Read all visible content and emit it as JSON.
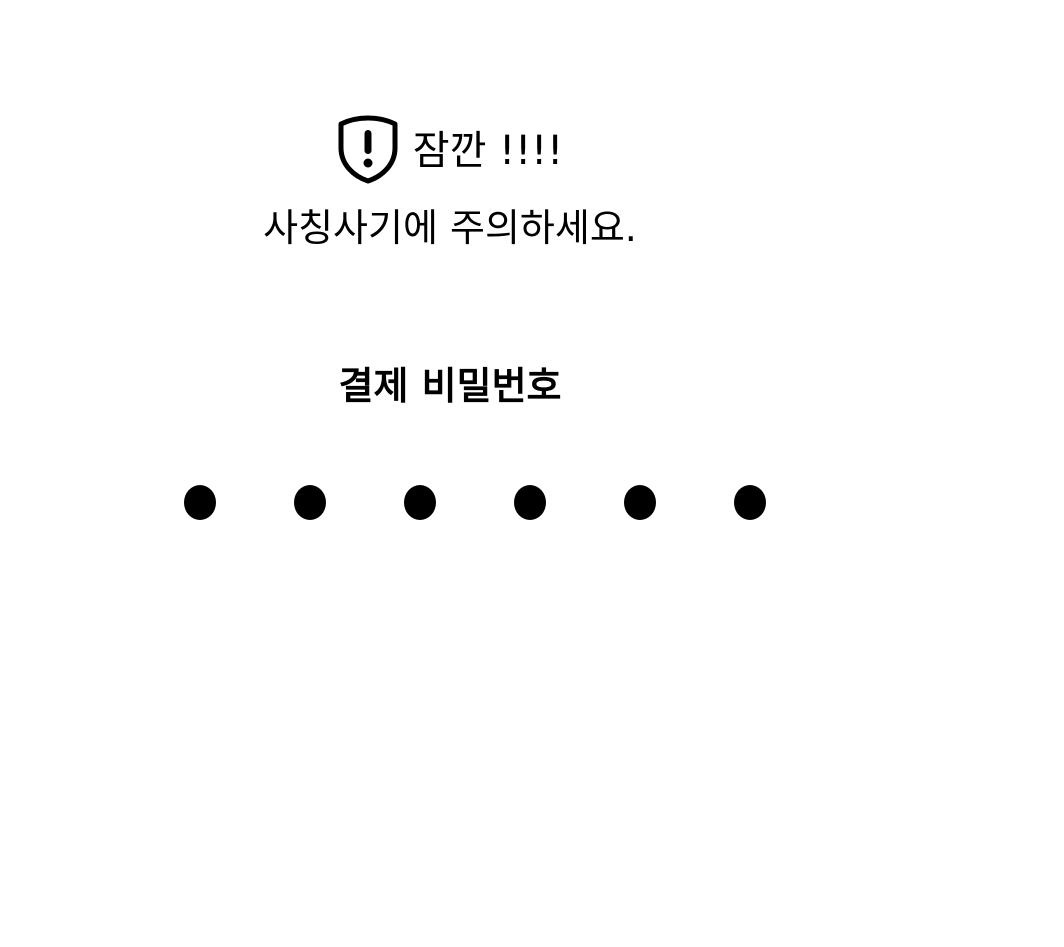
{
  "warning": {
    "icon": "shield-exclamation-icon",
    "title": "잠깐 !!!!",
    "message": "사칭사기에 주의하세요."
  },
  "pin": {
    "title": "결제 비밀번호",
    "length": 6,
    "entered": 6
  }
}
